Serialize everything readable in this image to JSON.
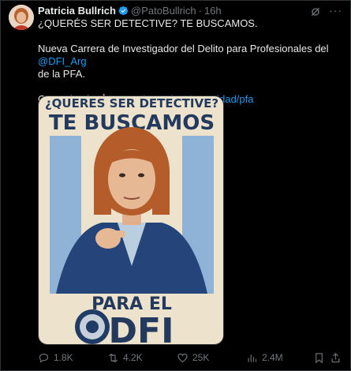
{
  "tweet": {
    "author_name": "Patricia Bullrich",
    "handle": "@PatoBullrich",
    "separator": "·",
    "time": "16h",
    "line1": "¿QUERÉS SER DETECTIVE? TE BUSCAMOS.",
    "line2_pre": "Nueva Carrera de Investigador del Delito para Profesionales del ",
    "line2_mention": "@DFI_Arg",
    "line3": "de la PFA.",
    "line4_pre": "Conocé más ",
    "line4_emoji": "👉🏻",
    "line4_link": "argentina.gob.ar/seguridad/pfa"
  },
  "poster": {
    "top_text": "¿QUERES SER DETECTIVE?",
    "headline": "TE BUSCAMOS",
    "bottom_line1": "PARA EL",
    "bottom_line2": "DFI"
  },
  "actions": {
    "replies": "1.8K",
    "reposts": "4.2K",
    "likes": "25K",
    "views": "2.4M"
  },
  "icons": {
    "verified": "verified-badge-icon",
    "grok": "grok-icon",
    "more": "more-icon",
    "reply": "reply-icon",
    "repost": "repost-icon",
    "like": "heart-icon",
    "views": "views-chart-icon",
    "bookmark": "bookmark-icon",
    "share": "share-icon"
  },
  "colors": {
    "background": "#000000",
    "text": "#e7e9ea",
    "muted": "#71767b",
    "link": "#1d9bf0",
    "verified": "#1d9bf0"
  }
}
